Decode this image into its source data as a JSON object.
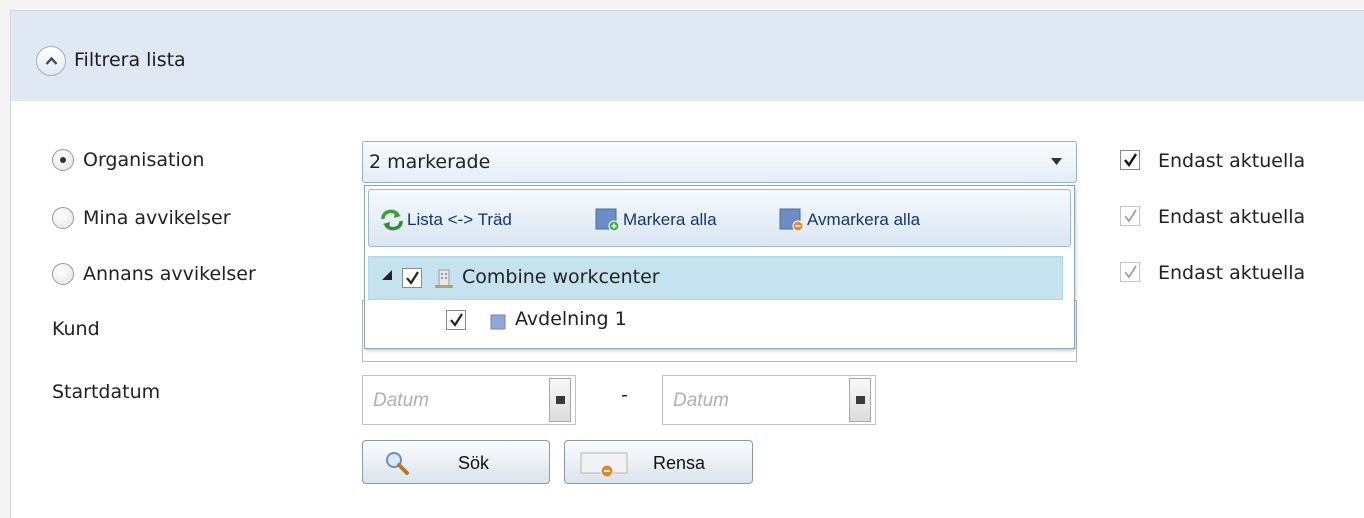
{
  "header": {
    "title": "Filtrera lista",
    "collapse_icon": "chevron-up-icon"
  },
  "filters": {
    "radios": [
      {
        "label": "Organisation",
        "checked": true
      },
      {
        "label": "Mina avvikelser",
        "checked": false
      },
      {
        "label": "Annans avvikelser",
        "checked": false
      }
    ],
    "kund_label": "Kund",
    "startdatum_label": "Startdatum"
  },
  "organisation_select": {
    "value": "2 markerade",
    "toolbar": {
      "toggle_view": "Lista <-> Träd",
      "select_all": "Markera alla",
      "deselect_all": "Avmarkera alla"
    },
    "tree": [
      {
        "label": "Combine workcenter",
        "checked": true,
        "expanded": true,
        "icon": "building-icon"
      },
      {
        "label": "Avdelning 1",
        "checked": true,
        "icon": "department-icon"
      }
    ]
  },
  "only_current": [
    {
      "label": "Endast aktuella",
      "checked": true,
      "enabled": true
    },
    {
      "label": "Endast aktuella",
      "checked": true,
      "enabled": false
    },
    {
      "label": "Endast aktuella",
      "checked": true,
      "enabled": false
    }
  ],
  "date_range": {
    "from_placeholder": "Datum",
    "separator": "-",
    "to_placeholder": "Datum"
  },
  "actions": {
    "search": "Sök",
    "clear": "Rensa"
  },
  "colors": {
    "header_bg": "#dfe8f3",
    "link": "#12366e",
    "selected_row": "#c5e3ef"
  }
}
